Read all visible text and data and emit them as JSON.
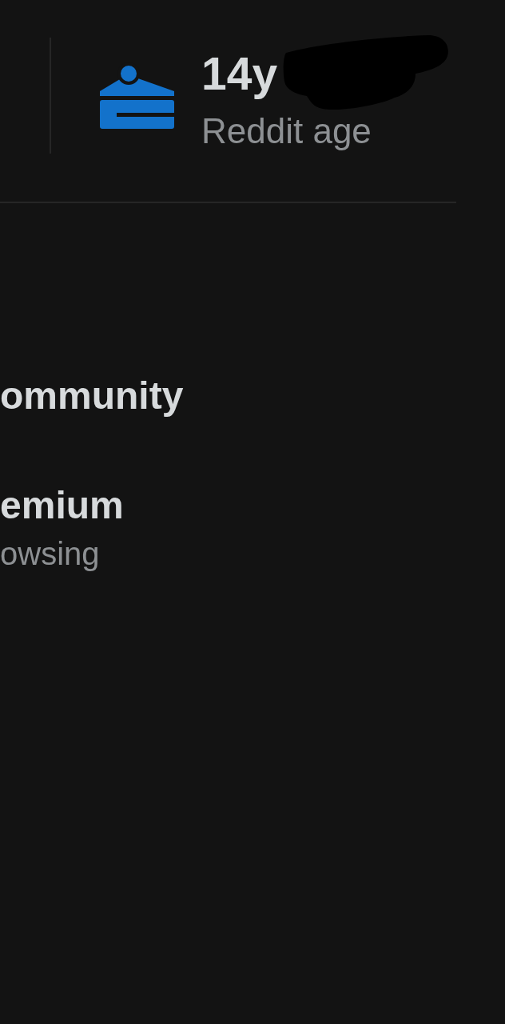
{
  "stat": {
    "value": "14y",
    "label": "Reddit age"
  },
  "menu_items": [
    {
      "title": "ommunity"
    },
    {
      "title": "emium",
      "subtitle": "owsing"
    }
  ]
}
